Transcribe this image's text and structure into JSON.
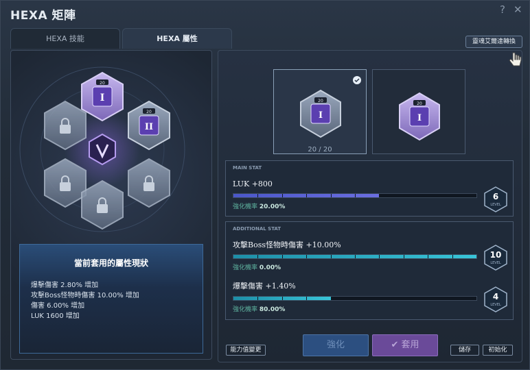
{
  "window": {
    "title": "HEXA 矩陣",
    "help": "?",
    "close": "✕"
  },
  "tabs": [
    {
      "label": "HEXA 技能",
      "active": false
    },
    {
      "label": "HEXA 屬性",
      "active": true
    }
  ],
  "hex_slots": {
    "center_icon": "v-matrix-icon",
    "slot_top_level": "20",
    "slot_right_level": "20",
    "slot_top_glyph": "I",
    "slot_right_glyph": "II"
  },
  "current_status": {
    "title": "當前套用的屬性現狀",
    "lines": [
      "爆擊傷害 2.80% 增加",
      "攻擊Boss怪物時傷害 10.00% 增加",
      "傷害 6.00% 增加",
      "LUK 1600 增加"
    ]
  },
  "swap_button": "靈魂艾爾達轉換",
  "cards": [
    {
      "level": "20",
      "count": "20 / 20",
      "selected": true
    },
    {
      "level": "20",
      "selected": false
    }
  ],
  "main_stat": {
    "header": "MAIN STAT",
    "name": "LUK +800",
    "rate_label": "強化機率",
    "rate_value": "20.00%",
    "progress": 0.6,
    "level": "6",
    "level_label": "LEVEL"
  },
  "additional_stats": {
    "header": "ADDITIONAL STAT",
    "items": [
      {
        "name": "攻擊Boss怪物時傷害 +10.00%",
        "rate_label": "強化機率",
        "rate_value": "0.00%",
        "progress": 1.0,
        "level": "10",
        "level_label": "LEVEL"
      },
      {
        "name": "爆擊傷害 +1.40%",
        "rate_label": "強化機率",
        "rate_value": "80.00%",
        "progress": 0.4,
        "level": "4",
        "level_label": "LEVEL"
      }
    ]
  },
  "buttons": {
    "stat_change": "能力值變更",
    "enhance": "強化",
    "apply": "套用",
    "save": "儲存",
    "reset": "初始化"
  },
  "colors": {
    "accent_purple": "#7b5cc4",
    "accent_cyan": "#38c4d8",
    "bar_purple": "#5a64d6"
  }
}
